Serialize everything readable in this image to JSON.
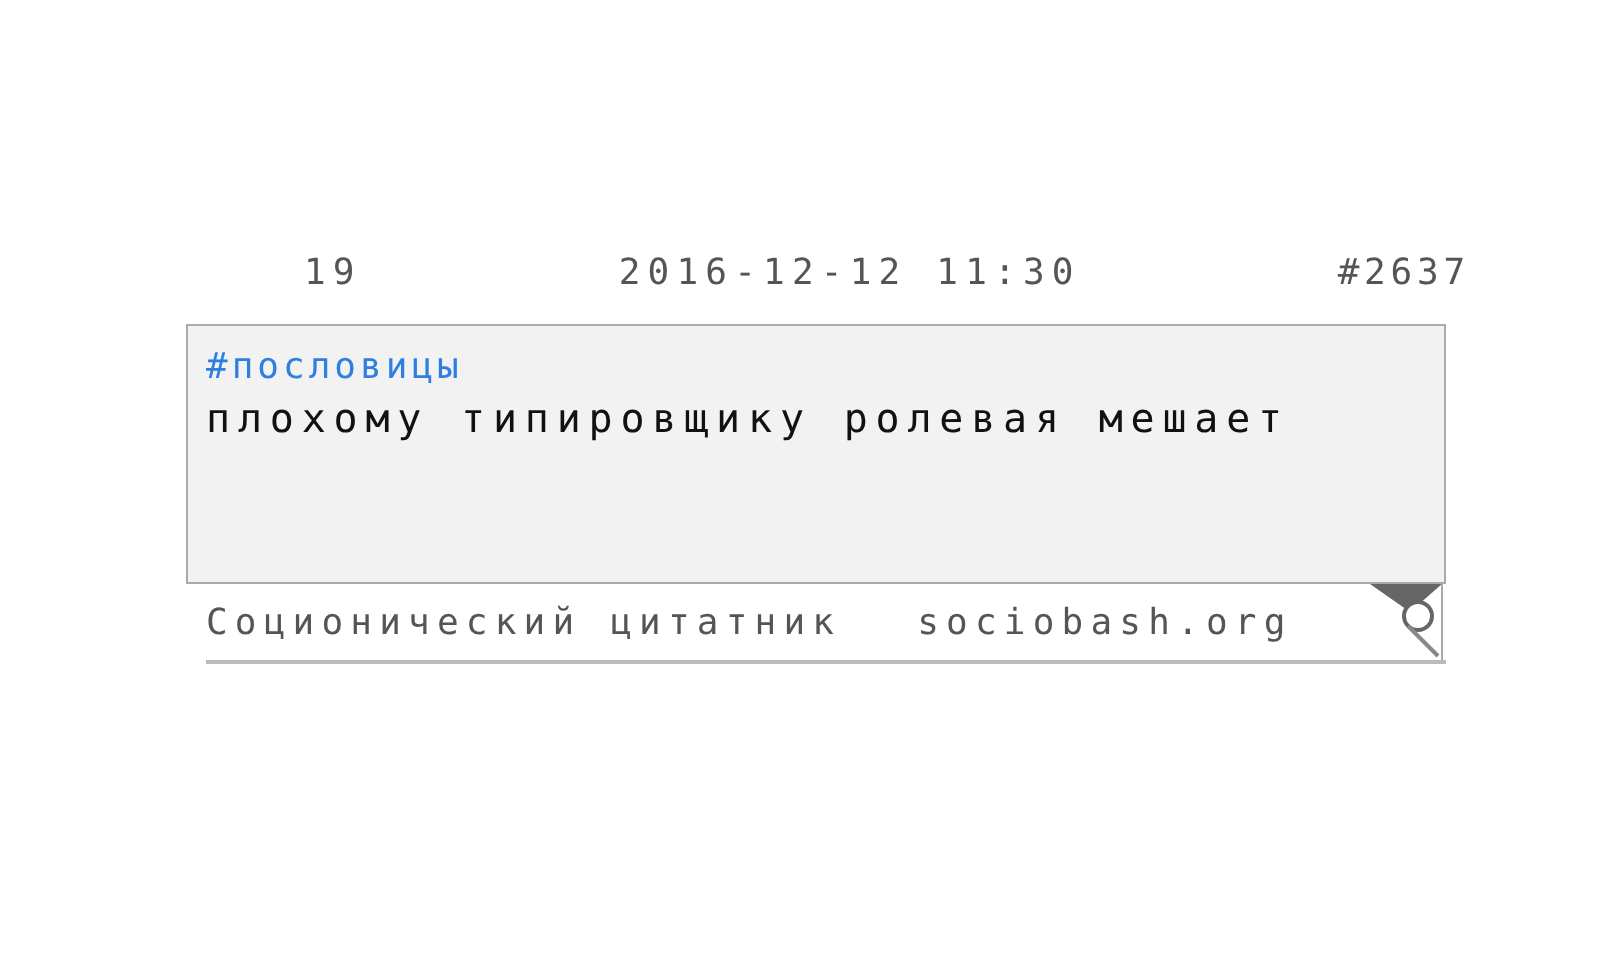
{
  "quote": {
    "rating": "19",
    "date": "2016-12-12 11:30",
    "number": "#2637",
    "tag": "#пословицы",
    "text": "плохому типировщику ролевая мешает"
  },
  "footer": {
    "site_name": "Соционический цитатник",
    "site_url": "sociobash.org"
  }
}
